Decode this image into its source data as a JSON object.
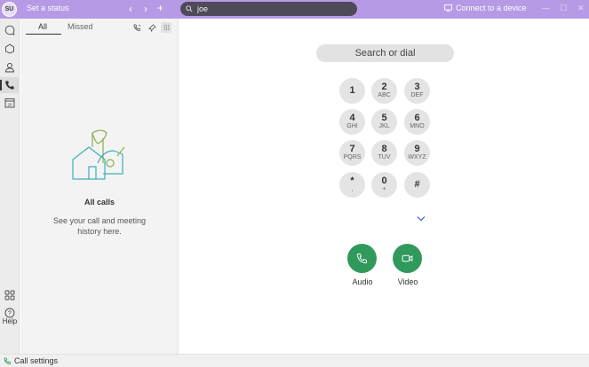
{
  "titlebar": {
    "avatar_initials": "SU",
    "status": "Set a status",
    "search_value": "joe",
    "connect_label": "Connect to a device",
    "back_icon": "‹",
    "forward_icon": "›",
    "new_icon": "+",
    "minimize": "—",
    "maximize": "☐",
    "close": "✕"
  },
  "rail": {
    "help_label": "Help",
    "icons": [
      "chat-icon",
      "team-icon",
      "contacts-icon",
      "calling-icon",
      "calendar-icon",
      "apps-icon",
      "help-icon"
    ]
  },
  "calls_panel": {
    "tabs": [
      {
        "label": "All",
        "selected": true
      },
      {
        "label": "Missed",
        "selected": false
      }
    ],
    "empty_title": "All calls",
    "empty_description": "See your call and meeting history here."
  },
  "dialpad": {
    "placeholder": "Search or dial",
    "keys": [
      {
        "digit": "1",
        "letters": ""
      },
      {
        "digit": "2",
        "letters": "ABC"
      },
      {
        "digit": "3",
        "letters": "DEF"
      },
      {
        "digit": "4",
        "letters": "GHI"
      },
      {
        "digit": "5",
        "letters": "JKL"
      },
      {
        "digit": "6",
        "letters": "MNO"
      },
      {
        "digit": "7",
        "letters": "PQRS"
      },
      {
        "digit": "8",
        "letters": "TUV"
      },
      {
        "digit": "9",
        "letters": "WXYZ"
      },
      {
        "digit": "*",
        "letters": ","
      },
      {
        "digit": "0",
        "letters": "+"
      },
      {
        "digit": "#",
        "letters": ""
      }
    ],
    "audio_label": "Audio",
    "video_label": "Video"
  },
  "bottombar": {
    "label": "Call settings"
  },
  "colors": {
    "titlebar": "#b79ae6",
    "search": "#4f4a59",
    "call_green": "#2f9a5b",
    "chevron_blue": "#2b5fd9"
  }
}
